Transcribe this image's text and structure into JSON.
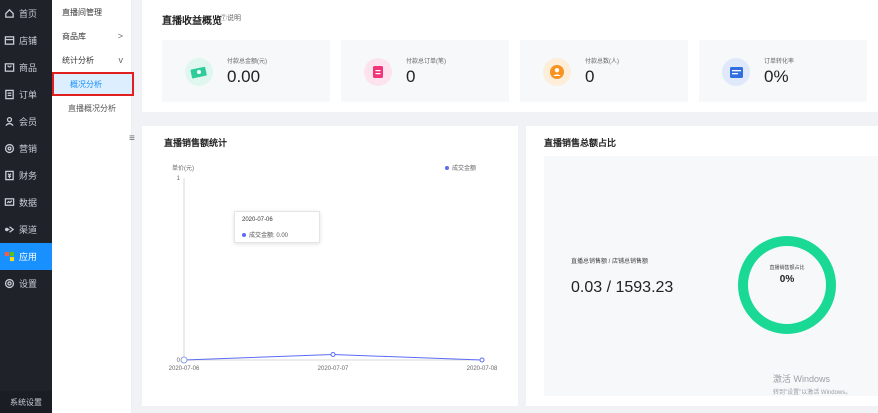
{
  "sidebar": {
    "items": [
      {
        "label": "首页",
        "icon": "home-icon"
      },
      {
        "label": "店铺",
        "icon": "store-icon"
      },
      {
        "label": "商品",
        "icon": "goods-icon"
      },
      {
        "label": "订单",
        "icon": "order-icon"
      },
      {
        "label": "会员",
        "icon": "member-icon"
      },
      {
        "label": "营销",
        "icon": "marketing-icon"
      },
      {
        "label": "财务",
        "icon": "finance-icon"
      },
      {
        "label": "数据",
        "icon": "data-icon"
      },
      {
        "label": "渠道",
        "icon": "channel-icon"
      },
      {
        "label": "应用",
        "icon": "apps-icon"
      },
      {
        "label": "设置",
        "icon": "settings-icon"
      }
    ],
    "active_index": 9,
    "footer": "系统设置"
  },
  "submenu": {
    "items": [
      {
        "label": "直播间管理"
      },
      {
        "label": "商品库",
        "chevron": ">"
      },
      {
        "label": "统计分析",
        "chevron": "v"
      }
    ],
    "children": [
      {
        "label": "概况分析",
        "active": true
      },
      {
        "label": "直播概况分析"
      }
    ],
    "collapse_glyph": "≡"
  },
  "summary": {
    "title": "直播收益概览",
    "help": "⑦说明",
    "stats": [
      {
        "label": "付款总金额(元)",
        "value": "0.00",
        "color": "#2ecc9a",
        "bg": "#dff7ee"
      },
      {
        "label": "付款总订单(笔)",
        "value": "0",
        "color": "#f0367a",
        "bg": "#fde3ec"
      },
      {
        "label": "付款总数(人)",
        "value": "0",
        "color": "#f7931e",
        "bg": "#fdeed9"
      },
      {
        "label": "订单转化率",
        "value": "0%",
        "color": "#2f6fe0",
        "bg": "#dfe9fb"
      }
    ]
  },
  "sales": {
    "title": "直播销售额统计",
    "unit": "单价(元)",
    "legend": "成交金额",
    "tooltip": {
      "date": "2020-07-06",
      "row": "成交金额:  0.00"
    }
  },
  "chart_data": {
    "type": "line",
    "x": [
      "2020-07-06",
      "2020-07-07",
      "2020-07-08"
    ],
    "series": [
      {
        "name": "成交金额",
        "values": [
          0,
          0.03,
          0
        ]
      }
    ],
    "ylim": [
      0,
      1
    ],
    "yticks": [
      "0",
      "1"
    ],
    "ylabel": "单价(元)",
    "legend_position": "top-right",
    "color": "#5b6cf5"
  },
  "ratio": {
    "title": "直播销售总额占比",
    "label": "直播总销售额 / 店铺总销售额",
    "value": "0.03 / 1593.23",
    "donut_label": "直播销售额占比",
    "donut_value": "0%",
    "donut_color": "#19d995"
  },
  "watermark": {
    "line1": "激活 Windows",
    "line2": "转到\"设置\"以激活 Windows。"
  }
}
